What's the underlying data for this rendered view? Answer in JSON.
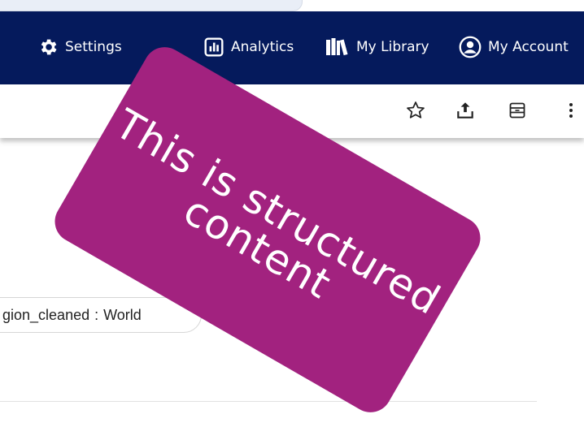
{
  "nav": {
    "settings_label": "Settings",
    "analytics_label": "Analytics",
    "library_label": "My Library",
    "account_label": "My Account"
  },
  "toolbar": {
    "icons": [
      "star-icon",
      "share-icon",
      "archive-icon",
      "more-vert-icon"
    ]
  },
  "filter": {
    "key": "gion_cleaned",
    "separator": ":",
    "value": "World"
  },
  "overlay": {
    "line1": "This is structured",
    "line2": "content"
  },
  "colors": {
    "nav_bg": "#051a5c",
    "banner_bg": "#a2227f",
    "text": "#222222"
  }
}
